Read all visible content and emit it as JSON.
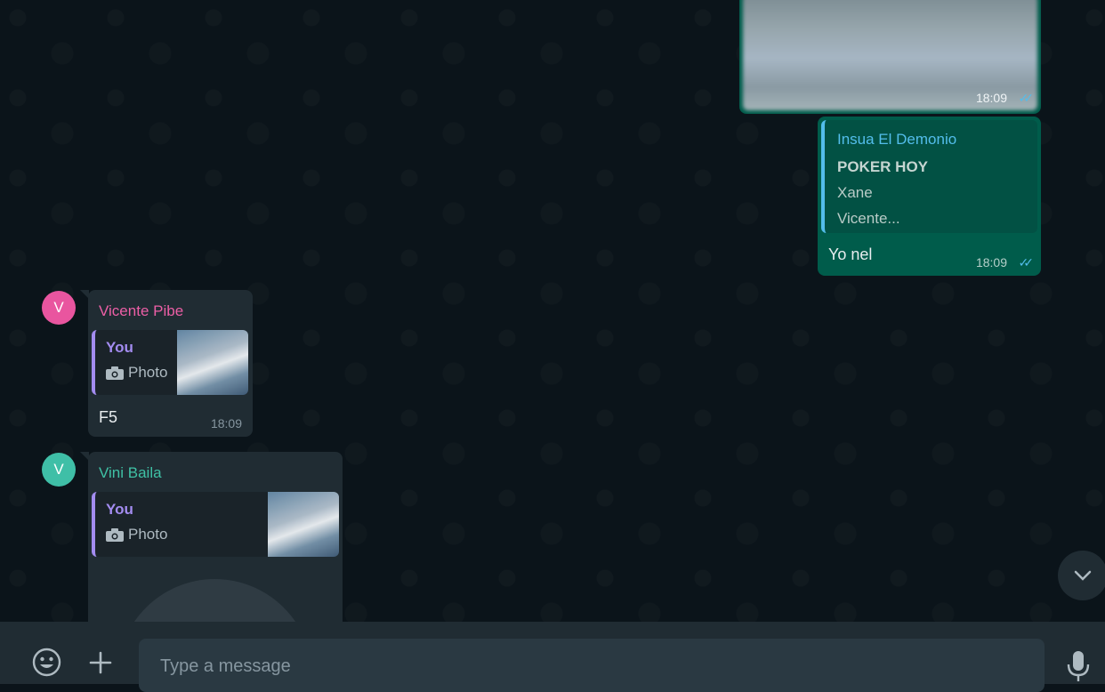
{
  "colors": {
    "outgoing_bubble": "#005c4b",
    "incoming_bubble": "#202c33",
    "read_ticks": "#53bdeb",
    "quote_accent_you": "#a38cf0",
    "sender_vicente": "#ec5fa6",
    "sender_vini": "#3fc1a5"
  },
  "messages": {
    "outgoing_photo": {
      "time": "18:09",
      "status_icon": "double-check-read-icon"
    },
    "outgoing_reply": {
      "quoted_sender": "Insua El Demonio",
      "quoted_title": "POKER HOY",
      "quoted_line1": "Xane",
      "quoted_line2": "Vicente...",
      "text": "Yo nel",
      "time": "18:09",
      "status_icon": "double-check-read-icon"
    },
    "vicente": {
      "avatar_letter": "V",
      "sender": "Vicente Pibe",
      "quote_author": "You",
      "quote_type": "Photo",
      "text": "F5",
      "time": "18:09"
    },
    "vini": {
      "avatar_letter": "V",
      "sender": "Vini Baila",
      "quote_author": "You",
      "quote_type": "Photo"
    }
  },
  "composer": {
    "placeholder": "Type a message",
    "emoji_icon": "emoji-icon",
    "attach_icon": "plus-icon",
    "mic_icon": "microphone-icon"
  },
  "scroll_down_icon": "chevron-down-icon"
}
